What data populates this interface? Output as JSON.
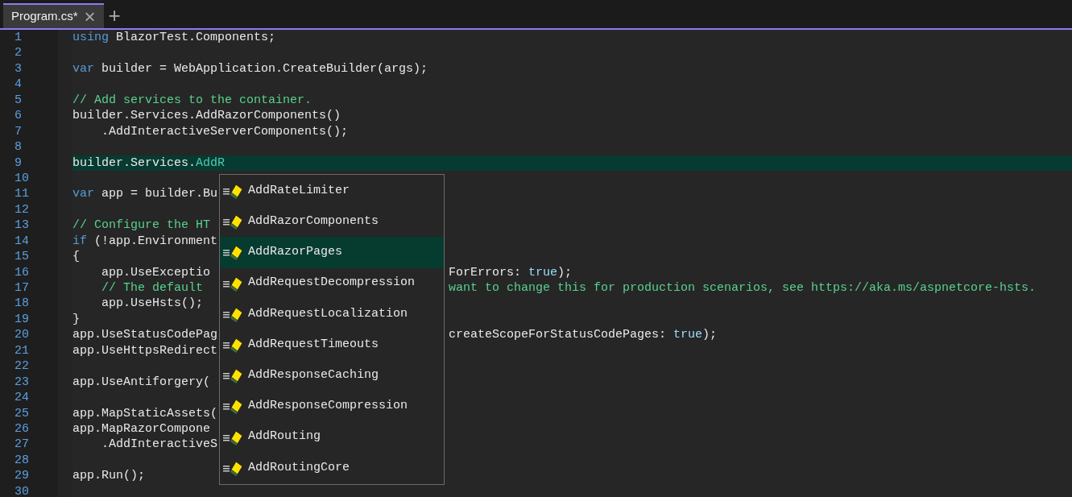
{
  "tabs": [
    {
      "label": "Program.cs*",
      "selected": true,
      "close": "×"
    }
  ],
  "new_tab": "+",
  "lines": [
    {
      "number": "1",
      "current": false,
      "tokens": [
        {
          "kind": "kw",
          "text": "using"
        },
        {
          "kind": "tx",
          "text": " BlazorTest.Components;"
        }
      ]
    },
    {
      "number": "2",
      "current": false
    },
    {
      "number": "3",
      "current": false,
      "tokens": [
        {
          "kind": "kw",
          "text": "var"
        },
        {
          "kind": "tx",
          "text": " builder = WebApplication.CreateBuilder(args);"
        }
      ]
    },
    {
      "number": "4",
      "current": false
    },
    {
      "number": "5",
      "current": false,
      "tokens": [
        {
          "kind": "cm",
          "text": "// Add services to the container."
        }
      ]
    },
    {
      "number": "6",
      "current": false,
      "tokens": [
        {
          "kind": "tx",
          "text": "builder.Services.AddRazorComponents()"
        }
      ]
    },
    {
      "number": "7",
      "current": false,
      "tokens": [
        {
          "kind": "tx",
          "text": "    .AddInteractiveServerComponents();"
        }
      ]
    },
    {
      "number": "8",
      "current": false
    },
    {
      "number": "9",
      "current": true,
      "tokens": [
        {
          "kind": "tx",
          "text": "builder.Services."
        },
        {
          "kind": "id",
          "text": "AddR"
        }
      ]
    },
    {
      "number": "10",
      "current": false
    },
    {
      "number": "11",
      "current": false,
      "tokens": [
        {
          "kind": "kw",
          "text": "var"
        },
        {
          "kind": "tx",
          "text": " app = builder.Bu"
        }
      ]
    },
    {
      "number": "12",
      "current": false
    },
    {
      "number": "13",
      "current": false,
      "tokens": [
        {
          "kind": "cm",
          "text": "// Configure the HT"
        }
      ]
    },
    {
      "number": "14",
      "current": false,
      "tokens": [
        {
          "kind": "kw",
          "text": "if"
        },
        {
          "kind": "tx",
          "text": " (!app.Environment"
        }
      ]
    },
    {
      "number": "15",
      "current": false,
      "tokens": [
        {
          "kind": "tx",
          "text": "{"
        }
      ]
    },
    {
      "number": "16",
      "current": false,
      "tokens": [
        {
          "kind": "tx",
          "text": "    app.UseExceptio"
        }
      ],
      "after": [
        {
          "kind": "tx",
          "text": "ForErrors: "
        },
        {
          "kind": "lit",
          "text": "true"
        },
        {
          "kind": "tx",
          "text": ");"
        }
      ]
    },
    {
      "number": "17",
      "current": false,
      "tokens": [
        {
          "kind": "cm",
          "text": "    // The default"
        }
      ],
      "after": [
        {
          "kind": "cm",
          "text": "want to change this for production scenarios, see https://aka.ms/aspnetcore-hsts."
        }
      ]
    },
    {
      "number": "18",
      "current": false,
      "tokens": [
        {
          "kind": "tx",
          "text": "    app.UseHsts();"
        }
      ]
    },
    {
      "number": "19",
      "current": false,
      "tokens": [
        {
          "kind": "tx",
          "text": "}"
        }
      ]
    },
    {
      "number": "20",
      "current": false,
      "tokens": [
        {
          "kind": "tx",
          "text": "app.UseStatusCodePag"
        }
      ],
      "after": [
        {
          "kind": "tx",
          "text": "createScopeForStatusCodePages: "
        },
        {
          "kind": "lit",
          "text": "true"
        },
        {
          "kind": "tx",
          "text": ");"
        }
      ]
    },
    {
      "number": "21",
      "current": false,
      "tokens": [
        {
          "kind": "tx",
          "text": "app.UseHttpsRedirect"
        }
      ]
    },
    {
      "number": "22",
      "current": false
    },
    {
      "number": "23",
      "current": false,
      "tokens": [
        {
          "kind": "tx",
          "text": "app.UseAntiforgery("
        }
      ]
    },
    {
      "number": "24",
      "current": false
    },
    {
      "number": "25",
      "current": false,
      "tokens": [
        {
          "kind": "tx",
          "text": "app.MapStaticAssets("
        }
      ]
    },
    {
      "number": "26",
      "current": false,
      "tokens": [
        {
          "kind": "tx",
          "text": "app.MapRazorCompone"
        }
      ]
    },
    {
      "number": "27",
      "current": false,
      "tokens": [
        {
          "kind": "tx",
          "text": "    .AddInteractiveS"
        }
      ]
    },
    {
      "number": "28",
      "current": false
    },
    {
      "number": "29",
      "current": false,
      "tokens": [
        {
          "kind": "tx",
          "text": "app.Run();"
        }
      ]
    },
    {
      "number": "30",
      "current": false
    }
  ],
  "completion": {
    "items": [
      {
        "label": "AddRateLimiter",
        "selected": false
      },
      {
        "label": "AddRazorComponents",
        "selected": false
      },
      {
        "label": "AddRazorPages",
        "selected": true
      },
      {
        "label": "AddRequestDecompression",
        "selected": false
      },
      {
        "label": "AddRequestLocalization",
        "selected": false
      },
      {
        "label": "AddRequestTimeouts",
        "selected": false
      },
      {
        "label": "AddResponseCaching",
        "selected": false
      },
      {
        "label": "AddResponseCompression",
        "selected": false
      },
      {
        "label": "AddRouting",
        "selected": false
      },
      {
        "label": "AddRoutingCore",
        "selected": false
      }
    ]
  }
}
